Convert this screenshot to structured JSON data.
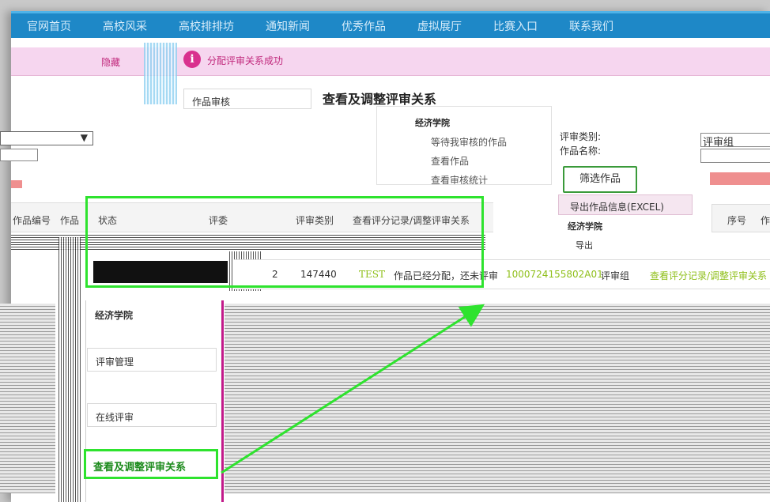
{
  "topnav": {
    "items": [
      "官网首页",
      "高校风采",
      "高校排排坊",
      "通知新闻",
      "优秀作品",
      "虚拟展厅",
      "比赛入口",
      "联系我们"
    ]
  },
  "notice": {
    "hide_label": "隐藏",
    "icon": "info-icon",
    "message": "分配评审关系成功"
  },
  "menu": {
    "audit_label": "作品审核",
    "page_title": "查看及调整评审关系"
  },
  "dropdown": {
    "heading": "经济学院",
    "items": [
      "等待我审核的作品",
      "查看作品",
      "查看审核统计"
    ]
  },
  "filter": {
    "category_label": "评审类别:",
    "name_label": "作品名称:",
    "category_value": "评审组",
    "button_label": "筛选作品",
    "export_label": "导出作品信息(EXCEL)",
    "export_heading": "经济学院",
    "export_item": "导出"
  },
  "table": {
    "headers": [
      "作品编号",
      "作品",
      "状态",
      "评委",
      "评审类别",
      "查看评分记录/调整评审关系"
    ],
    "right_headers": [
      "序号",
      "作"
    ],
    "row": {
      "index": "2",
      "id": "147440",
      "name": "TEST",
      "status": "作品已经分配，还未评审",
      "judge": "1000724155802A01",
      "category": "评审组",
      "action": "查看评分记录/调整评审关系"
    }
  },
  "sidebar": {
    "college": "经济学院",
    "review_manage": "评审管理",
    "online_review": "在线评审",
    "current": "查看及调整评审关系"
  },
  "colors": {
    "highlight": "#2ee32e",
    "nav": "#1e88c7",
    "notice": "#c12a7d",
    "link_green": "#8fbf1a"
  }
}
